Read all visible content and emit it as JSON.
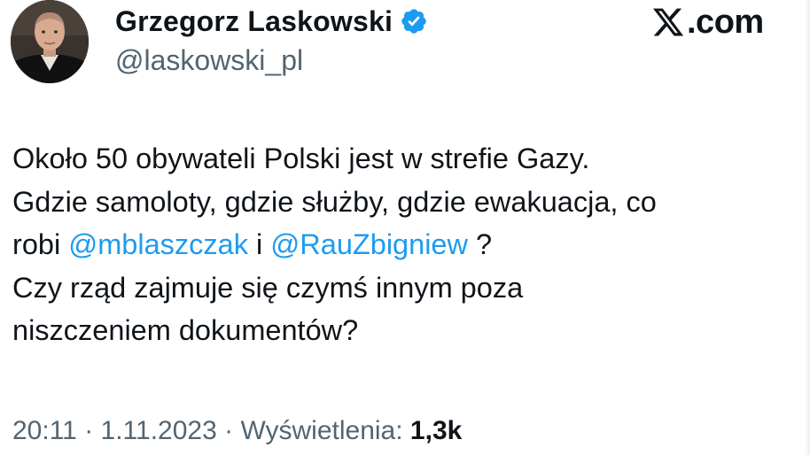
{
  "author": {
    "display_name": "Grzegorz Laskowski",
    "handle": "@laskowski_pl",
    "verified_icon": "verified-badge-icon",
    "avatar_icon": "profile-photo"
  },
  "brand": {
    "icon": "x-logo-icon",
    "text": ".com"
  },
  "tweet": {
    "line1": "Około 50 obywateli Polski jest w strefie Gazy.",
    "line2": "Gdzie samoloty, gdzie służby, gdzie ewakuacja, co",
    "line3_prefix": "robi ",
    "mention1": "@mblaszczak",
    "line3_middle": " i ",
    "mention2": "@RauZbigniew",
    "line3_suffix": " ?",
    "line4": "Czy rząd zajmuje się czymś innym poza",
    "line5": "niszczeniem dokumentów?"
  },
  "meta": {
    "time": "20:11",
    "sep1": " · ",
    "date": "1.11.2023",
    "sep2": " · ",
    "views_label": "Wyświetlenia: ",
    "views_count": "1,3k"
  },
  "colors": {
    "text": "#0f1419",
    "secondary": "#536471",
    "link": "#1d9bf0",
    "verified": "#1d9bf0"
  }
}
